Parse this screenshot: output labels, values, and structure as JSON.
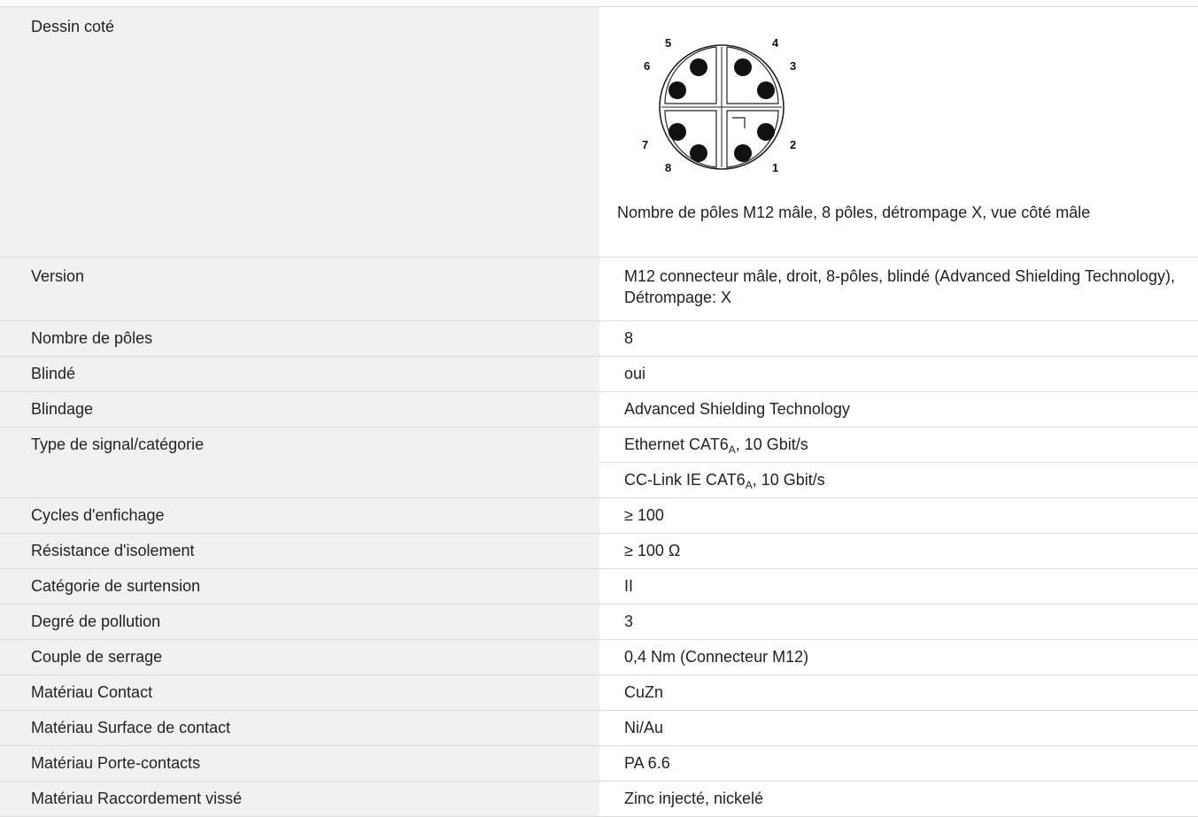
{
  "drawing": {
    "label": "Dessin coté",
    "pin_numbers": [
      "1",
      "2",
      "3",
      "4",
      "5",
      "6",
      "7",
      "8"
    ],
    "caption": "Nombre de pôles M12 mâle, 8 pôles, détrompage X, vue côté mâle"
  },
  "version": {
    "label": "Version",
    "value": "M12 connecteur mâle, droit, 8-pôles, blindé (Advanced Shielding Technology), Détrompage: X"
  },
  "poles": {
    "label": "Nombre de pôles",
    "value": "8"
  },
  "shielded": {
    "label": "Blindé",
    "value": "oui"
  },
  "shielding": {
    "label": "Blindage",
    "value": "Advanced Shielding Technology"
  },
  "signal": {
    "label": "Type de signal/catégorie",
    "values": [
      {
        "prefix": "Ethernet CAT6",
        "sub": "A",
        "suffix": ", 10 Gbit/s"
      },
      {
        "prefix": "CC-Link IE CAT6",
        "sub": "A",
        "suffix": ", 10 Gbit/s"
      }
    ]
  },
  "cycles": {
    "label": "Cycles d'enfichage",
    "value": "≥ 100"
  },
  "insulation": {
    "label": "Résistance d'isolement",
    "value": "≥ 100 Ω"
  },
  "overvoltage": {
    "label": "Catégorie de surtension",
    "value": "II"
  },
  "pollution": {
    "label": "Degré de pollution",
    "value": "3"
  },
  "torque": {
    "label": "Couple de serrage",
    "value": "0,4 Nm (Connecteur M12)"
  },
  "contact_material": {
    "label": "Matériau Contact",
    "value": "CuZn"
  },
  "surface_material": {
    "label": "Matériau Surface de contact",
    "value": "Ni/Au"
  },
  "carrier_material": {
    "label": "Matériau Porte-contacts",
    "value": "PA 6.6"
  },
  "screw_material": {
    "label": "Matériau Raccordement vissé",
    "value": "Zinc injecté, nickelé"
  }
}
